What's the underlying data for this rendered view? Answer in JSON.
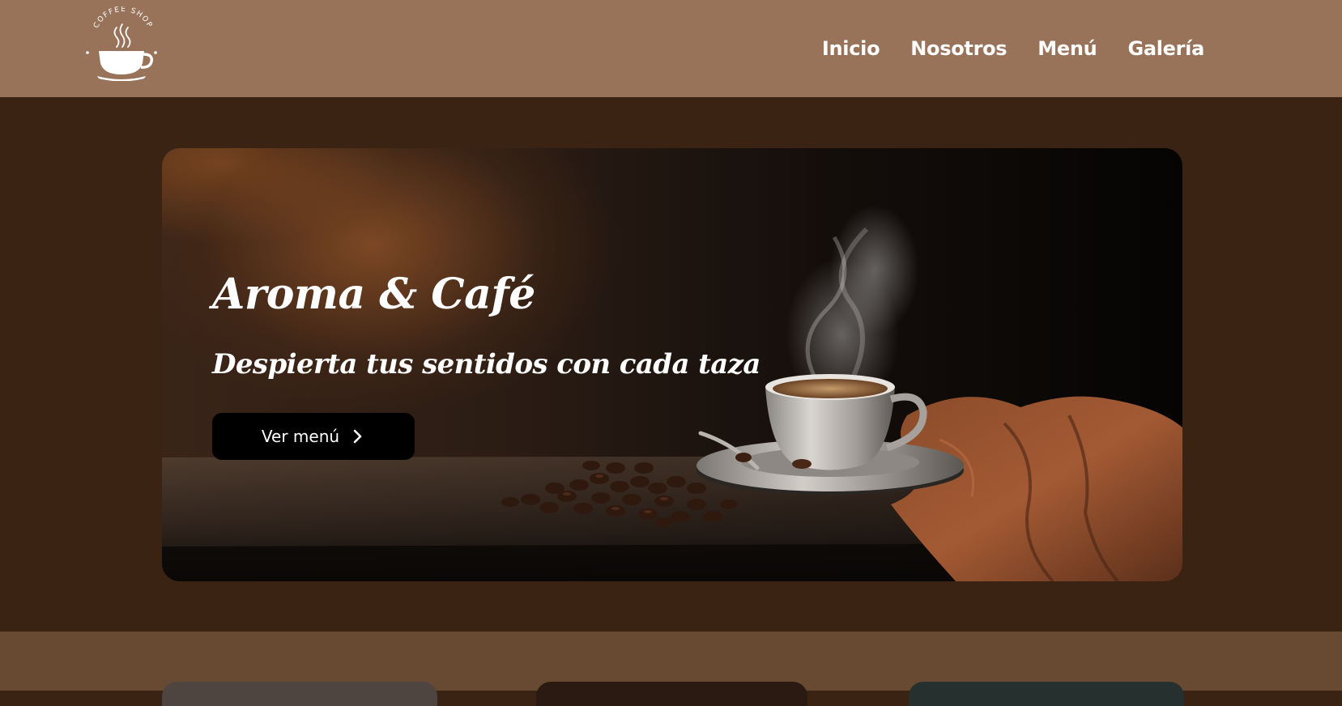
{
  "header": {
    "logo": {
      "text": "COFFEE SHOP",
      "icon": "coffee-cup-logo-icon"
    },
    "nav": [
      {
        "label": "Inicio"
      },
      {
        "label": "Nosotros"
      },
      {
        "label": "Menú"
      },
      {
        "label": "Galería"
      }
    ]
  },
  "hero": {
    "title": "Aroma & Café",
    "subtitle": "Despierta tus sentidos con cada taza",
    "button_label": "Ver menú",
    "button_icon": "chevron-right-icon"
  },
  "colors": {
    "header_bg": "#98735a",
    "hero_section_bg": "#3b2314",
    "lower_section_bg": "#684a32",
    "button_bg": "#000000",
    "text": "#ffffff"
  }
}
